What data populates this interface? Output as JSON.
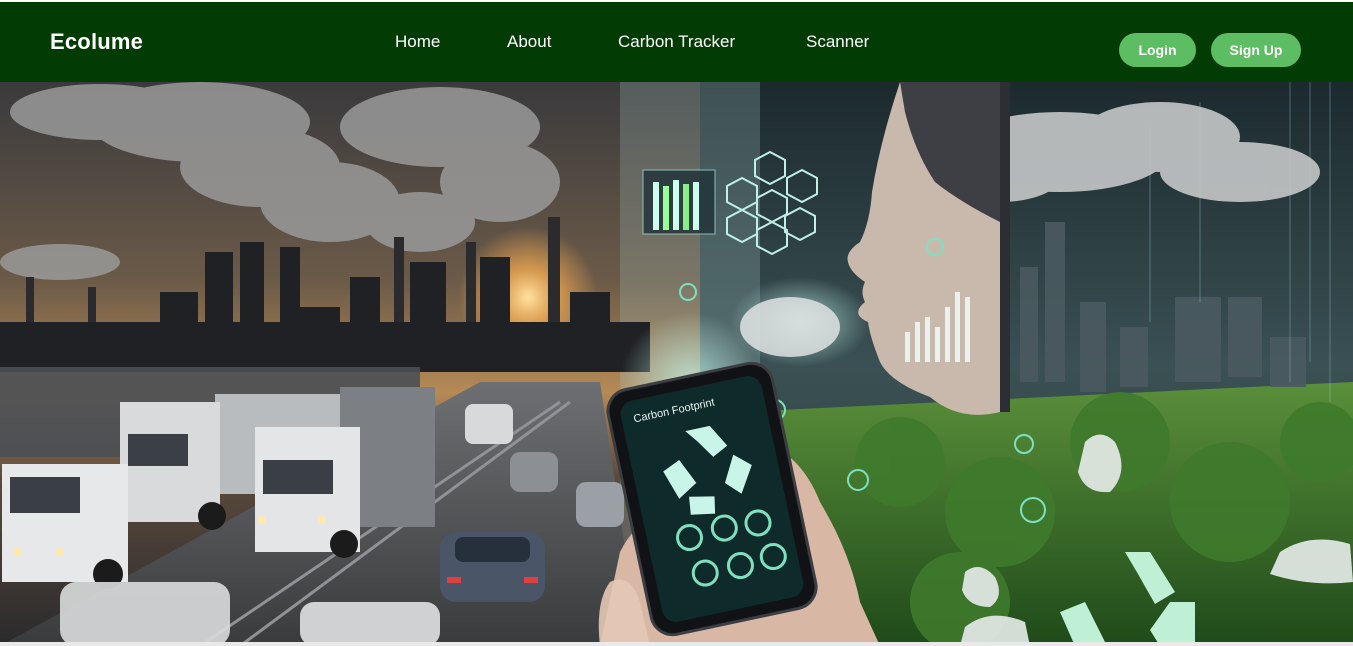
{
  "brand": {
    "name": "Ecolume"
  },
  "nav": {
    "items": [
      {
        "label": "Home"
      },
      {
        "label": "About"
      },
      {
        "label": "Carbon Tracker"
      },
      {
        "label": "Scanner"
      }
    ]
  },
  "auth": {
    "login_label": "Login",
    "signup_label": "Sign Up"
  },
  "hero": {
    "phone_label": "Carbon Footprint",
    "colors": {
      "navbar": "#033b05",
      "button": "#5cbd62",
      "accent": "#7fe0c0"
    }
  }
}
